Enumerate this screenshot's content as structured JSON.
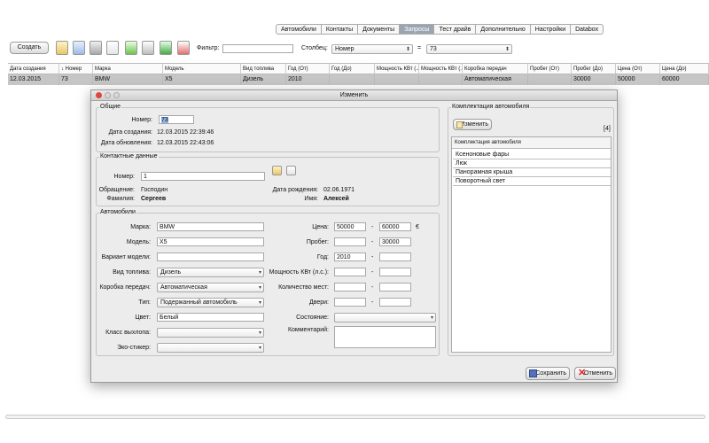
{
  "tabs": [
    "Автомобили",
    "Контакты",
    "Документы",
    "Запросы",
    "Тест драйв",
    "Дополнительно",
    "Настройки",
    "Databox"
  ],
  "toolbar": {
    "create_label": "Создать",
    "filter_label": "Фильтр:",
    "filter_value": "",
    "column_label": "Столбец:",
    "column_value": "Номер",
    "operator_value": "=",
    "search_value": "73"
  },
  "table": {
    "headers": [
      "Дата создания",
      "↓ Номер",
      "Марка",
      "Модель",
      "Вид топлива",
      "Год (От)",
      "Год (До)",
      "Мощность КВт (...",
      "Мощность КВт (...",
      "Коробка передач",
      "Пробег (От)",
      "Пробег (До)",
      "Цена (От)",
      "Цена (До)"
    ],
    "row": [
      "12.03.2015",
      "73",
      "BMW",
      "X5",
      "Дизель",
      "2010",
      "",
      "",
      "",
      "Автоматическая",
      "",
      "30000",
      "50000",
      "60000"
    ]
  },
  "dialog": {
    "title": "Изменить",
    "general": {
      "title": "Общие",
      "number_label": "Номер:",
      "number_value": "73",
      "created_label": "Дата создания:",
      "created_value": "12.03.2015 22:39:46",
      "updated_label": "Дата обновления:",
      "updated_value": "12.03.2015 22:43:06"
    },
    "contact": {
      "title": "Контактные данные",
      "number_label": "Номер:",
      "number_value": "1",
      "salutation_label": "Обращение:",
      "salutation_value": "Господин",
      "surname_label": "Фамилия:",
      "surname_value": "Сергеев",
      "birth_label": "Дата рождения:",
      "birth_value": "02.06.1971",
      "name_label": "Имя:",
      "name_value": "Алексей"
    },
    "cars": {
      "title": "Автомобили",
      "make_label": "Марка:",
      "make_value": "BMW",
      "model_label": "Модель:",
      "model_value": "X5",
      "variant_label": "Вариант модели:",
      "variant_value": "",
      "fuel_label": "Вид топлива:",
      "fuel_value": "Дизель",
      "gearbox_label": "Коробка передач:",
      "gearbox_value": "Автоматическая",
      "type_label": "Тип:",
      "type_value": "Подержанный автомобиль",
      "color_label": "Цвет:",
      "color_value": "Белый",
      "emission_label": "Класс выхлопа:",
      "emission_value": "",
      "sticker_label": "Эко-стикер:",
      "sticker_value": "",
      "price_label": "Цена:",
      "price_from": "50000",
      "price_to": "60000",
      "currency": "€",
      "mileage_label": "Пробег:",
      "mileage_from": "",
      "mileage_to": "30000",
      "year_label": "Год:",
      "year_from": "2010",
      "year_to": "",
      "power_label": "Мощность КВт (л.с.):",
      "seats_label": "Количество мест:",
      "doors_label": "Двери:",
      "state_label": "Состояние:",
      "state_value": "",
      "comment_label": "Комментарий:",
      "dash": "-"
    },
    "equipment": {
      "title": "Комплектация автомобиля",
      "edit_label": "Изменить",
      "count": "[4]",
      "column": "Комплектация автомобиля",
      "items": [
        "Ксеноновые фары",
        "Люк",
        "Панорамная крыша",
        "Поворотный свет"
      ]
    },
    "save_label": "Сохранить",
    "cancel_label": "Отменить"
  }
}
